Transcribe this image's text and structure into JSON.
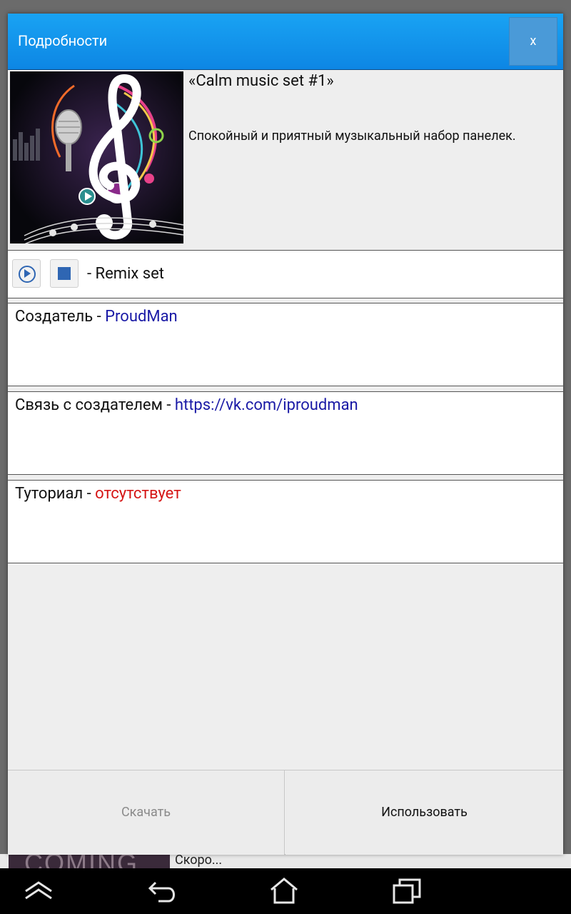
{
  "background": {
    "thumb_text": "COMING",
    "caption": "Скоро..."
  },
  "dialog": {
    "title": "Подробности",
    "close_label": "x"
  },
  "pack": {
    "title": "«Calm music set #1»",
    "description": "Спокойный и приятный музыкальный набор панелек.",
    "cover_icon": "treble-clef-microphone-art"
  },
  "player": {
    "label": "- Remix set"
  },
  "creator": {
    "prefix": "Создатель - ",
    "value": "ProudMan"
  },
  "contact": {
    "prefix": "Связь с создателем - ",
    "value": "https://vk.com/iproudman"
  },
  "tutorial": {
    "prefix": "Туториал - ",
    "value": "отсутствует"
  },
  "footer": {
    "download_label": "Скачать",
    "use_label": "Использовать"
  },
  "colors": {
    "header": "#0d86e4",
    "link": "#1a1aa6",
    "missing": "#d51414",
    "player_icon": "#2f66b3"
  },
  "navbar": {
    "icons": [
      "navigate-down-icon",
      "back-icon",
      "home-icon",
      "recent-apps-icon"
    ]
  }
}
